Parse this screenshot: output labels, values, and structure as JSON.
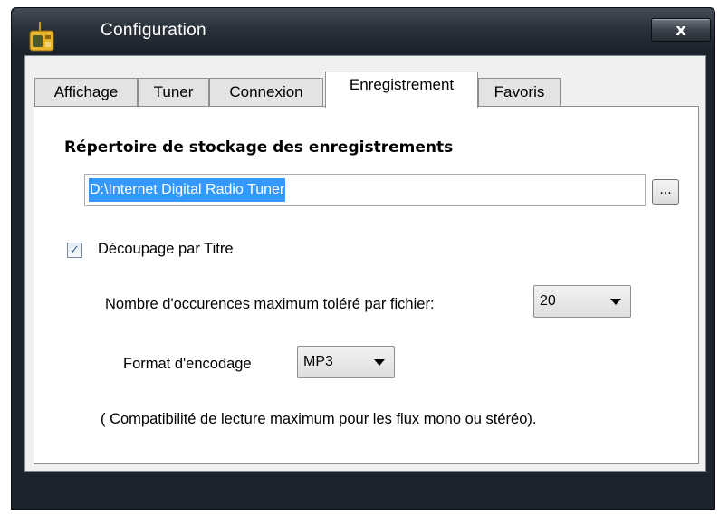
{
  "window": {
    "title": "Configuration",
    "close_label": "x"
  },
  "tabs": [
    {
      "label": "Affichage",
      "active": false
    },
    {
      "label": "Tuner",
      "active": false
    },
    {
      "label": "Connexion",
      "active": false
    },
    {
      "label": "Enregistrement",
      "active": true
    },
    {
      "label": "Favoris",
      "active": false
    }
  ],
  "recording": {
    "section_title": "Répertoire de stockage des enregistrements",
    "directory_value": "D:\\Internet Digital Radio Tuner",
    "browse_label": "...",
    "split_by_title_label": "Découpage par Titre",
    "split_by_title_checked": true,
    "max_occurrences_label": "Nombre d'occurences maximum toléré par fichier:",
    "max_occurrences_value": "20",
    "encoding_label": "Format d'encodage",
    "encoding_value": "MP3",
    "compat_note": "( Compatibilité de lecture maximum pour les flux mono ou stéréo)."
  },
  "icons": {
    "app": "radio-icon",
    "close": "close-icon",
    "checkbox_check": "checkmark-icon",
    "dropdown": "chevron-down-icon"
  },
  "colors": {
    "selection": "#3399ff",
    "titlebar": "#2a313b",
    "checkmark": "#3b5e8a"
  }
}
